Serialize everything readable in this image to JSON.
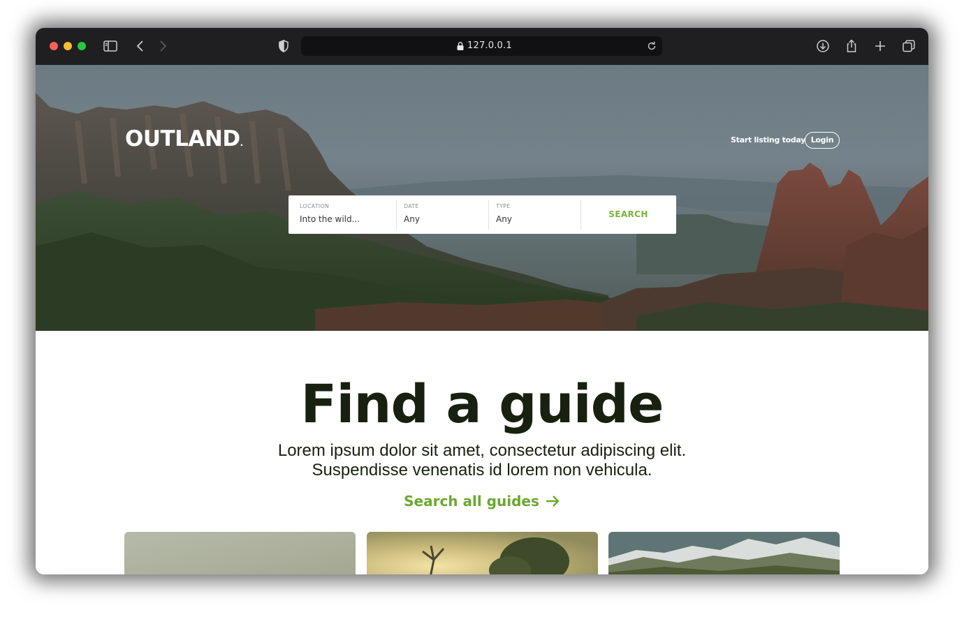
{
  "browser": {
    "url": "127.0.0.1"
  },
  "site": {
    "logo": "OUTLAND",
    "logo_mark": ".",
    "nav": {
      "start_listing": "Start listing today",
      "login": "Login"
    },
    "search": {
      "location_label": "LOCATION",
      "location_value": "Into the wild...",
      "date_label": "DATE",
      "date_value": "Any",
      "type_label": "TYPE",
      "type_value": "Any",
      "button": "SEARCH"
    }
  },
  "content": {
    "headline": "Find a guide",
    "subline_1": "Lorem ipsum dolor sit amet, consectetur adipiscing elit.",
    "subline_2": "Suspendisse venenatis id lorem non vehicula.",
    "link": "Search all guides"
  },
  "colors": {
    "accent": "#6aa82f",
    "headline": "#18200f"
  }
}
